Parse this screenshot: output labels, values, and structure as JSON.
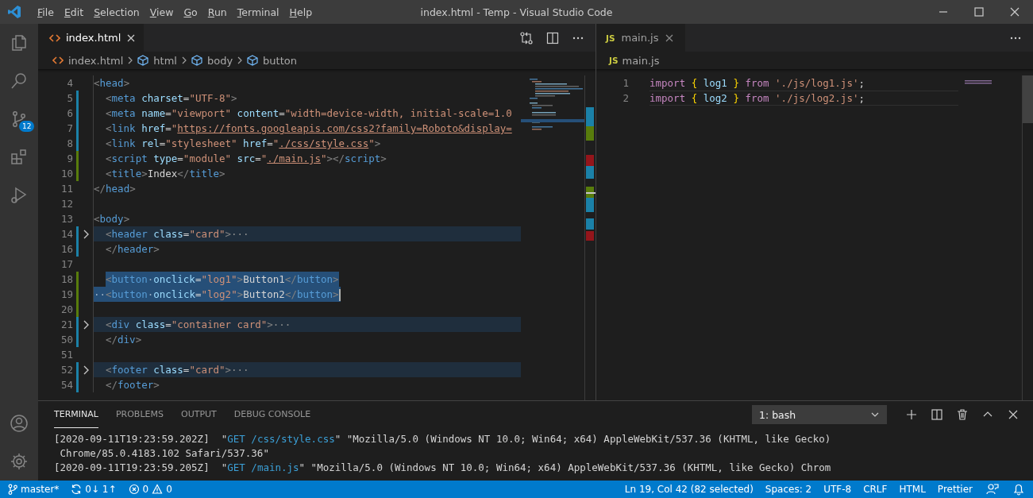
{
  "title_bar": {
    "menu": [
      "File",
      "Edit",
      "Selection",
      "View",
      "Go",
      "Run",
      "Terminal",
      "Help"
    ],
    "title": "index.html - Temp - Visual Studio Code"
  },
  "activity_bar": {
    "items": [
      {
        "kind": "files"
      },
      {
        "kind": "search"
      },
      {
        "kind": "source-control",
        "badge": "12"
      },
      {
        "kind": "extensions"
      },
      {
        "kind": "run"
      }
    ],
    "bottom": [
      {
        "kind": "account"
      },
      {
        "kind": "settings"
      }
    ]
  },
  "left_editor": {
    "tabs": [
      {
        "label": "index.html",
        "kind": "html",
        "selected": true
      }
    ],
    "breadcrumb": [
      {
        "label": "index.html",
        "kind": "file"
      },
      {
        "label": "html",
        "kind": "element"
      },
      {
        "label": "body",
        "kind": "element"
      },
      {
        "label": "button",
        "kind": "element"
      }
    ],
    "lines": [
      {
        "number": "4",
        "indented": false,
        "folded": false,
        "selected": false,
        "cursor": false,
        "tokens": [
          {
            "kind": "bracket",
            "text": "<"
          },
          {
            "kind": "tag",
            "text": "head"
          },
          {
            "kind": "bracket",
            "text": ">"
          }
        ]
      },
      {
        "number": "5",
        "indented": true,
        "color": "#1b81a8",
        "folded": false,
        "selected": false,
        "cursor": false,
        "tokens": [
          {
            "kind": "bracket",
            "text": "<"
          },
          {
            "kind": "tag",
            "text": "meta"
          },
          {
            "kind": "attr",
            "text": " charset"
          },
          {
            "kind": "plain",
            "text": "="
          },
          {
            "kind": "string",
            "text": "\"UTF-8\""
          },
          {
            "kind": "bracket",
            "text": ">"
          }
        ]
      },
      {
        "number": "6",
        "indented": true,
        "color": "#1b81a8",
        "folded": false,
        "selected": false,
        "cursor": false,
        "tokens": [
          {
            "kind": "bracket",
            "text": "<"
          },
          {
            "kind": "tag",
            "text": "meta"
          },
          {
            "kind": "attr",
            "text": " name"
          },
          {
            "kind": "plain",
            "text": "="
          },
          {
            "kind": "string",
            "text": "\"viewport\""
          },
          {
            "kind": "attr",
            "text": " content"
          },
          {
            "kind": "plain",
            "text": "="
          },
          {
            "kind": "string",
            "text": "\"width=device-width, initial-scale=1.0"
          }
        ]
      },
      {
        "number": "7",
        "indented": true,
        "color": "#1b81a8",
        "folded": false,
        "selected": false,
        "cursor": false,
        "tokens": [
          {
            "kind": "bracket",
            "text": "<"
          },
          {
            "kind": "tag",
            "text": "link"
          },
          {
            "kind": "attr",
            "text": " href"
          },
          {
            "kind": "plain",
            "text": "="
          },
          {
            "kind": "string",
            "text": "\""
          },
          {
            "kind": "link",
            "text": "https://fonts.googleapis.com/css2?family=Roboto&display="
          }
        ]
      },
      {
        "number": "8",
        "indented": true,
        "color": "#1b81a8",
        "folded": false,
        "selected": false,
        "cursor": false,
        "tokens": [
          {
            "kind": "bracket",
            "text": "<"
          },
          {
            "kind": "tag",
            "text": "link"
          },
          {
            "kind": "attr",
            "text": " rel"
          },
          {
            "kind": "plain",
            "text": "="
          },
          {
            "kind": "string",
            "text": "\"stylesheet\""
          },
          {
            "kind": "attr",
            "text": " href"
          },
          {
            "kind": "plain",
            "text": "="
          },
          {
            "kind": "string",
            "text": "\""
          },
          {
            "kind": "link",
            "text": "./css/style.css"
          },
          {
            "kind": "string",
            "text": "\""
          },
          {
            "kind": "bracket",
            "text": ">"
          }
        ]
      },
      {
        "number": "9",
        "indented": true,
        "color": "#587c0c",
        "folded": false,
        "selected": false,
        "cursor": false,
        "tokens": [
          {
            "kind": "bracket",
            "text": "<"
          },
          {
            "kind": "tag",
            "text": "script"
          },
          {
            "kind": "attr",
            "text": " type"
          },
          {
            "kind": "plain",
            "text": "="
          },
          {
            "kind": "string",
            "text": "\"module\""
          },
          {
            "kind": "attr",
            "text": " src"
          },
          {
            "kind": "plain",
            "text": "="
          },
          {
            "kind": "string",
            "text": "\""
          },
          {
            "kind": "link",
            "text": "./main.js"
          },
          {
            "kind": "string",
            "text": "\""
          },
          {
            "kind": "bracket",
            "text": "></"
          },
          {
            "kind": "tag",
            "text": "script"
          },
          {
            "kind": "bracket",
            "text": ">"
          }
        ]
      },
      {
        "number": "10",
        "indented": true,
        "color": "#587c0c",
        "folded": false,
        "selected": false,
        "cursor": false,
        "tokens": [
          {
            "kind": "bracket",
            "text": "<"
          },
          {
            "kind": "tag",
            "text": "title"
          },
          {
            "kind": "bracket",
            "text": ">"
          },
          {
            "kind": "plain",
            "text": "Index"
          },
          {
            "kind": "bracket",
            "text": "</"
          },
          {
            "kind": "tag",
            "text": "title"
          },
          {
            "kind": "bracket",
            "text": ">"
          }
        ]
      },
      {
        "number": "11",
        "indented": false,
        "folded": false,
        "selected": false,
        "cursor": false,
        "tokens": [
          {
            "kind": "bracket",
            "text": "</"
          },
          {
            "kind": "tag",
            "text": "head"
          },
          {
            "kind": "bracket",
            "text": ">"
          }
        ]
      },
      {
        "number": "12"
      },
      {
        "number": "13",
        "indented": false,
        "folded": false,
        "selected": false,
        "cursor": false,
        "tokens": [
          {
            "kind": "bracket",
            "text": "<"
          },
          {
            "kind": "tag",
            "text": "body"
          },
          {
            "kind": "bracket",
            "text": ">"
          }
        ]
      },
      {
        "number": "14",
        "indented": true,
        "color": "#1b81a8",
        "folded": true,
        "selected": false,
        "cursor": false,
        "tokens": [
          {
            "kind": "bracket",
            "text": "<"
          },
          {
            "kind": "tag",
            "text": "header"
          },
          {
            "kind": "attr",
            "text": " class"
          },
          {
            "kind": "plain",
            "text": "="
          },
          {
            "kind": "string",
            "text": "\"card\""
          },
          {
            "kind": "bracket",
            "text": ">"
          },
          {
            "kind": "fold",
            "text": "···"
          }
        ]
      },
      {
        "number": "16",
        "indented": true,
        "color": "#1b81a8",
        "folded": false,
        "selected": false,
        "cursor": false,
        "tokens": [
          {
            "kind": "bracket",
            "text": "</"
          },
          {
            "kind": "tag",
            "text": "header"
          },
          {
            "kind": "bracket",
            "text": ">"
          }
        ]
      },
      {
        "number": "17"
      },
      {
        "number": "18",
        "indented": true,
        "color": "#587c0c",
        "folded": false,
        "selected": true,
        "cursor": false,
        "tokens": [
          {
            "kind": "bracket",
            "text": "<"
          },
          {
            "kind": "tag",
            "text": "button"
          },
          {
            "kind": "whitespace",
            "text": "·"
          },
          {
            "kind": "attr",
            "text": "onclick"
          },
          {
            "kind": "plain",
            "text": "="
          },
          {
            "kind": "string",
            "text": "\"log1\""
          },
          {
            "kind": "bracket",
            "text": ">"
          },
          {
            "kind": "plain",
            "text": "Button1"
          },
          {
            "kind": "bracket",
            "text": "</"
          },
          {
            "kind": "tag",
            "text": "button"
          },
          {
            "kind": "bracket",
            "text": ">"
          }
        ]
      },
      {
        "number": "19",
        "indented": false,
        "color": "#587c0c",
        "folded": false,
        "selected": true,
        "cursor": true,
        "tokens": [
          {
            "kind": "whitespace",
            "text": "··"
          },
          {
            "kind": "bracket",
            "text": "<"
          },
          {
            "kind": "tag",
            "text": "button"
          },
          {
            "kind": "whitespace",
            "text": "·"
          },
          {
            "kind": "attr",
            "text": "onclick"
          },
          {
            "kind": "plain",
            "text": "="
          },
          {
            "kind": "string",
            "text": "\"log2\""
          },
          {
            "kind": "bracket",
            "text": ">"
          },
          {
            "kind": "plain",
            "text": "Button2"
          },
          {
            "kind": "bracket",
            "text": "</"
          },
          {
            "kind": "tag",
            "text": "button"
          },
          {
            "kind": "bracket",
            "text": ">"
          }
        ]
      },
      {
        "number": "20",
        "color": "#587c0c"
      },
      {
        "number": "21",
        "indented": true,
        "color": "#1b81a8",
        "folded": true,
        "selected": false,
        "cursor": false,
        "tokens": [
          {
            "kind": "bracket",
            "text": "<"
          },
          {
            "kind": "tag",
            "text": "div"
          },
          {
            "kind": "attr",
            "text": " class"
          },
          {
            "kind": "plain",
            "text": "="
          },
          {
            "kind": "string",
            "text": "\"container card\""
          },
          {
            "kind": "bracket",
            "text": ">"
          },
          {
            "kind": "fold",
            "text": "···"
          }
        ]
      },
      {
        "number": "50",
        "indented": true,
        "color": "#1b81a8",
        "folded": false,
        "selected": false,
        "cursor": false,
        "tokens": [
          {
            "kind": "bracket",
            "text": "</"
          },
          {
            "kind": "tag",
            "text": "div"
          },
          {
            "kind": "bracket",
            "text": ">"
          }
        ]
      },
      {
        "number": "51"
      },
      {
        "number": "52",
        "indented": true,
        "color": "#1b81a8",
        "folded": true,
        "selected": false,
        "cursor": false,
        "tokens": [
          {
            "kind": "bracket",
            "text": "<"
          },
          {
            "kind": "tag",
            "text": "footer"
          },
          {
            "kind": "attr",
            "text": " class"
          },
          {
            "kind": "plain",
            "text": "="
          },
          {
            "kind": "string",
            "text": "\"card\""
          },
          {
            "kind": "bracket",
            "text": ">"
          },
          {
            "kind": "fold",
            "text": "···"
          }
        ]
      },
      {
        "number": "54",
        "indented": true,
        "color": "#1b81a8",
        "folded": false,
        "selected": false,
        "cursor": false,
        "tokens": [
          {
            "kind": "bracket",
            "text": "</"
          },
          {
            "kind": "tag",
            "text": "footer"
          },
          {
            "kind": "bracket",
            "text": ">"
          }
        ]
      }
    ]
  },
  "right_editor": {
    "tabs": [
      {
        "label": "main.js",
        "badge": "JS",
        "selected": true
      }
    ],
    "breadcrumb": [
      {
        "badge": "JS",
        "label": "main.js"
      }
    ],
    "lines": [
      {
        "number": "1",
        "current": false,
        "tokens": [
          {
            "kind": "keyword",
            "text": "import"
          },
          {
            "kind": "brace",
            "text": " {"
          },
          {
            "kind": "variable",
            "text": " log1"
          },
          {
            "kind": "brace",
            "text": " }"
          },
          {
            "kind": "keyword",
            "text": " from"
          },
          {
            "kind": "string",
            "text": " './js/log1.js'"
          },
          {
            "kind": "plain",
            "text": ";"
          }
        ]
      },
      {
        "number": "2",
        "current": true,
        "tokens": [
          {
            "kind": "keyword",
            "text": "import"
          },
          {
            "kind": "brace",
            "text": " {"
          },
          {
            "kind": "variable",
            "text": " log2"
          },
          {
            "kind": "brace",
            "text": " }"
          },
          {
            "kind": "keyword",
            "text": " from"
          },
          {
            "kind": "string",
            "text": " './js/log2.js'"
          },
          {
            "kind": "plain",
            "text": ";"
          }
        ]
      }
    ]
  },
  "panel": {
    "tabs": [
      {
        "label": "TERMINAL",
        "selected": true
      },
      {
        "label": "PROBLEMS",
        "selected": false
      },
      {
        "label": "OUTPUT",
        "selected": false
      },
      {
        "label": "DEBUG CONSOLE",
        "selected": false
      }
    ],
    "terminal_select": "1: bash",
    "lines": [
      [
        {
          "kind": "plain",
          "text": "[2020-09-11T19:23:59.202Z]  \""
        },
        {
          "kind": "request",
          "text": "GET /css/style.css"
        },
        {
          "kind": "plain",
          "text": "\" \"Mozilla/5.0 (Windows NT 10.0; Win64; x64) AppleWebKit/537.36 (KHTML, like Gecko)"
        }
      ],
      [
        {
          "kind": "plain",
          "text": " Chrome/85.0.4183.102 Safari/537.36\""
        }
      ],
      [
        {
          "kind": "plain",
          "text": "[2020-09-11T19:23:59.205Z]  \""
        },
        {
          "kind": "request",
          "text": "GET /main.js"
        },
        {
          "kind": "plain",
          "text": "\" \"Mozilla/5.0 (Windows NT 10.0; Win64; x64) AppleWebKit/537.36 (KHTML, like Gecko) Chrom"
        }
      ]
    ]
  },
  "status_bar": {
    "left": [
      {
        "kind": "branch",
        "text": "master*"
      },
      {
        "kind": "sync",
        "text": "0↓ 1↑"
      },
      {
        "kind": "problems",
        "errors": "0",
        "warnings": "0"
      }
    ],
    "right": [
      {
        "kind": "text",
        "text": "Ln 19, Col 42 (82 selected)"
      },
      {
        "kind": "text",
        "text": "Spaces: 2"
      },
      {
        "kind": "text",
        "text": "UTF-8"
      },
      {
        "kind": "text",
        "text": "CRLF"
      },
      {
        "kind": "text",
        "text": "HTML"
      },
      {
        "kind": "text",
        "text": "Prettier"
      },
      {
        "kind": "feedback"
      },
      {
        "kind": "bell"
      }
    ]
  }
}
